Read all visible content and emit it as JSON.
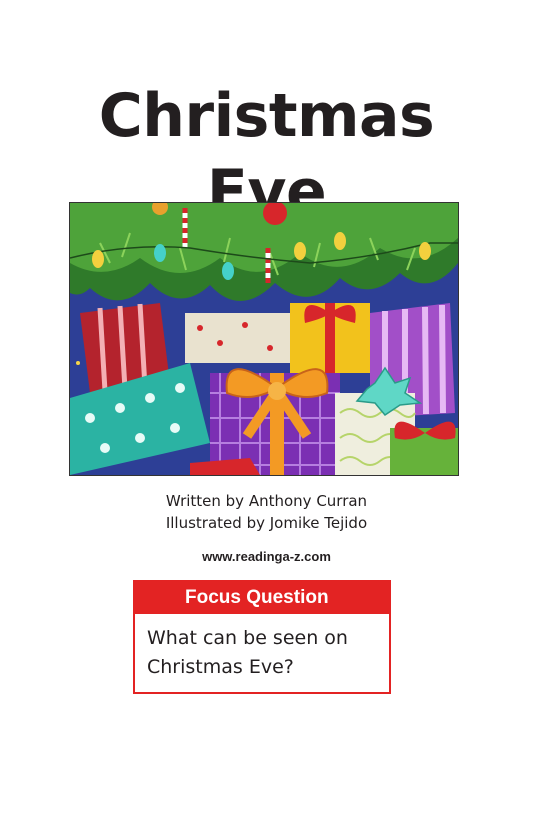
{
  "cover": {
    "title_line1": "Christmas",
    "title_line2": "Eve",
    "written_by": "Written by Anthony Curran",
    "illustrated_by": "Illustrated by Jomike Tejido",
    "website": "www.readinga-z.com"
  },
  "focus_question": {
    "heading": "Focus Question",
    "text": "What can be seen on Christmas Eve?"
  },
  "colors": {
    "accent_red": "#e32323",
    "text": "#231f20"
  }
}
